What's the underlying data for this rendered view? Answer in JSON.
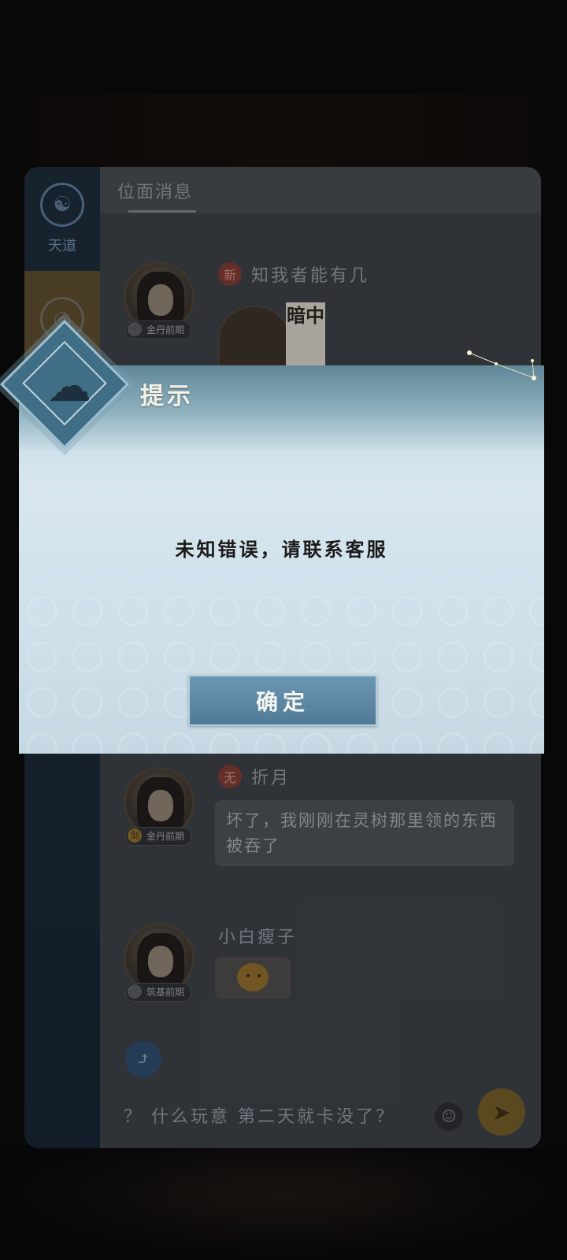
{
  "sidebar": {
    "tabs": [
      {
        "label": "天道",
        "icon": "taiji-icon"
      },
      {
        "label": "",
        "icon": "planet-icon"
      }
    ]
  },
  "content": {
    "title": "位面消息"
  },
  "messages": [
    {
      "name": "知我者能有几",
      "badge": "新",
      "rank": "金丹前期",
      "rank_icon": "·",
      "card_text": "暗中"
    },
    {
      "name": "折月",
      "badge": "无",
      "rank": "金丹前期",
      "rank_icon": "剑",
      "text": "坏了，我刚刚在灵树那里领的东西被吞了"
    },
    {
      "name": "小白瘦子",
      "rank": "筑基前期",
      "rank_icon": "·"
    }
  ],
  "input": {
    "value": "？ 什么玩意 第二天就卡没了？"
  },
  "dialog": {
    "title": "提示",
    "message": "未知错误，请联系客服",
    "confirm_label": "确定"
  },
  "colors": {
    "dialog_header": "#5f8798",
    "confirm_button": "#5b86a4",
    "panel_bg": "#3a3f45"
  }
}
